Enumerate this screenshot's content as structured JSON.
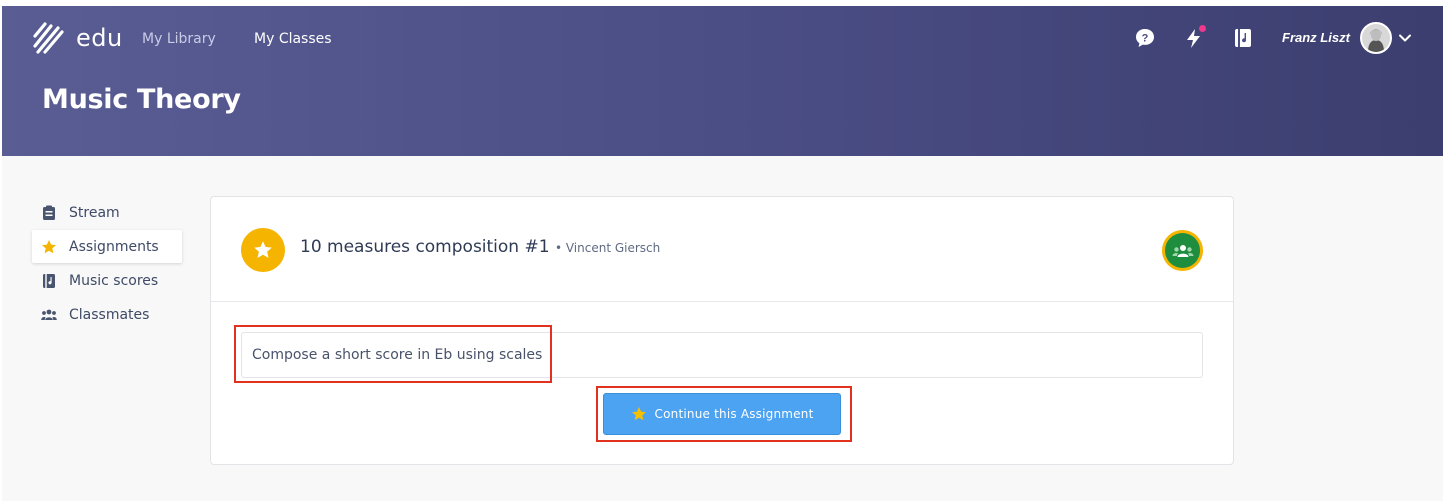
{
  "app": {
    "logo_text": "edu",
    "nav": [
      {
        "label": "My Library",
        "active": false
      },
      {
        "label": "My Classes",
        "active": true
      }
    ],
    "page_title": "Music Theory",
    "user_name": "Franz Liszt"
  },
  "header_icons": [
    "help-icon",
    "notifications-icon",
    "music-score-icon",
    "chevron-down-icon"
  ],
  "sidebar": {
    "items": [
      {
        "label": "Stream",
        "icon": "clipboard-icon",
        "active": false
      },
      {
        "label": "Assignments",
        "icon": "star-icon",
        "active": true
      },
      {
        "label": "Music scores",
        "icon": "music-score-icon",
        "active": false
      },
      {
        "label": "Classmates",
        "icon": "people-icon",
        "active": false
      }
    ]
  },
  "assignment": {
    "title": "10 measures composition #1",
    "author": "• Vincent Giersch",
    "description": "Compose a short score in Eb using scales",
    "continue_label": "Continue this Assignment"
  },
  "colors": {
    "header_start": "#595d93",
    "header_end": "#3c3e6f",
    "accent_yellow": "#f5b400",
    "button_blue": "#4ba3f2",
    "classroom_green": "#1e8e3e",
    "highlight_red": "#e0321e"
  }
}
